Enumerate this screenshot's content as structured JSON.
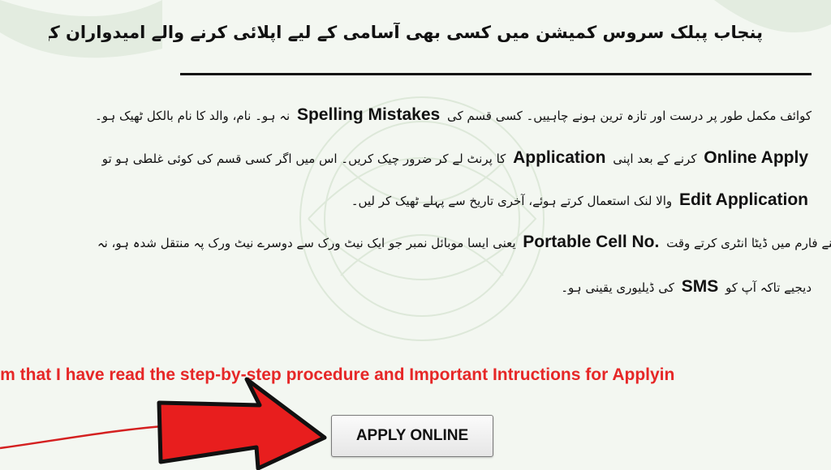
{
  "heading": "پنجاب پبلک سروس کمیشن میں کسی بھی آسامی کے لیے اپلائی کرنے والے امیدواران کے لئے ضروری ہدایات",
  "instructions": [
    {
      "before": "کوائف مکمل طور پر درست اور تازہ ترین ہونے چاہییں۔ کسی قسم کی",
      "english": "Spelling Mistakes",
      "after": "نہ ہو۔ نام، والد کا نام بالکل ٹھیک ہو۔"
    },
    {
      "before": "",
      "english": "Online Apply",
      "after": "کرنے کے بعد اپنی"
    },
    {
      "before": "",
      "english": "Edit Application",
      "after": "والا لنک استعمال کرتے ہوئے، آخری تاریخ سے پہلے ٹھیک کر لیں۔"
    },
    {
      "before": "اپنے فارم میں ڈیٹا انٹری کرتے وقت",
      "english": "Portable Cell No.",
      "after": "یعنی ایسا موبائل نمبر جو ایک نیٹ ورک سے دوسرے نیٹ ورک پہ منتقل شدہ ہو، نہ"
    },
    {
      "before": "دیجیے تاکہ آپ کو",
      "english": "SMS",
      "after": "کی ڈیلیوری یقینی ہو۔"
    }
  ],
  "line2_extra": {
    "english": "Application",
    "after": "کا پرنٹ لے کر ضرور چیک کریں۔ اس میں اگر کسی قسم کی کوئی غلطی ہو تو"
  },
  "confirm_text": "rm that I have read the step-by-step procedure and Important Intructions for Applyin",
  "apply_button": "APPLY ONLINE",
  "colors": {
    "confirm_text": "#e62727",
    "arrow_fill": "#e81e1e",
    "arrow_outline": "#111111",
    "background": "#f3f7f1"
  }
}
